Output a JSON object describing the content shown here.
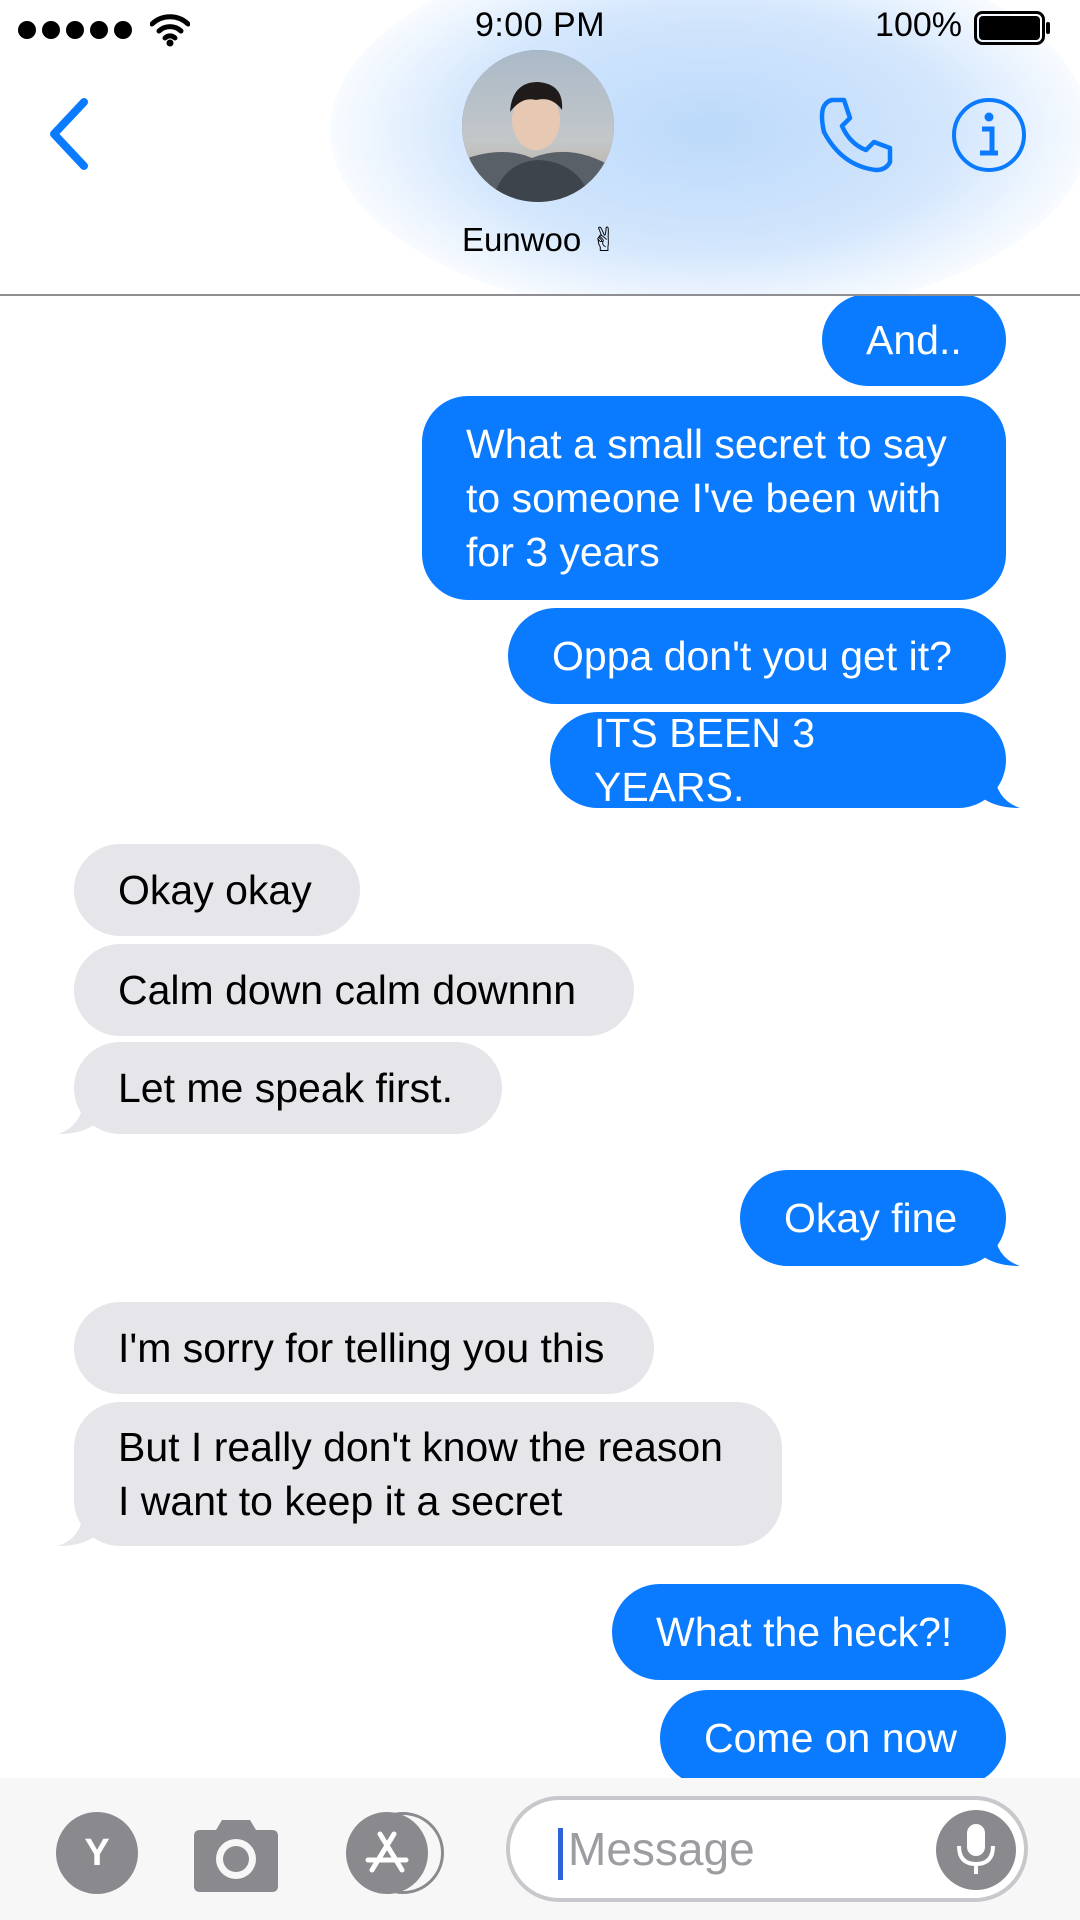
{
  "status_bar": {
    "time": "9:00 PM",
    "battery_percent": "100%",
    "signal_icon": "signal-dots-icon",
    "wifi_icon": "wifi-icon",
    "battery_icon": "battery-icon"
  },
  "header": {
    "contact_name": "Eunwoo ✌",
    "back_icon": "chevron-left-icon",
    "call_icon": "phone-icon",
    "info_icon": "info-icon",
    "accent_color": "#0a7aff"
  },
  "messages": [
    {
      "side": "sent",
      "text": "And.."
    },
    {
      "side": "sent",
      "text": "What a small secret to say\nto someone I've been with\nfor 3 years"
    },
    {
      "side": "sent",
      "text": "Oppa don't you get it?"
    },
    {
      "side": "sent",
      "text": "ITS BEEN 3 YEARS."
    },
    {
      "side": "received",
      "text": "Okay okay"
    },
    {
      "side": "received",
      "text": "Calm down calm downnn"
    },
    {
      "side": "received",
      "text": "Let me speak first."
    },
    {
      "side": "sent",
      "text": "Okay fine"
    },
    {
      "side": "received",
      "text": "I'm sorry for telling you this"
    },
    {
      "side": "received",
      "text": "But I really don't know the reason\nI want to keep it a secret"
    },
    {
      "side": "sent",
      "text": "What the heck?!"
    },
    {
      "side": "sent",
      "text": "Come on now"
    }
  ],
  "input_bar": {
    "app_y_label": "Y",
    "placeholder": "Message",
    "camera_icon": "camera-icon",
    "appstore_icon": "app-store-icon",
    "mic_icon": "microphone-icon"
  },
  "colors": {
    "sent_bubble": "#0a7aff",
    "received_bubble": "#e5e5ea"
  }
}
